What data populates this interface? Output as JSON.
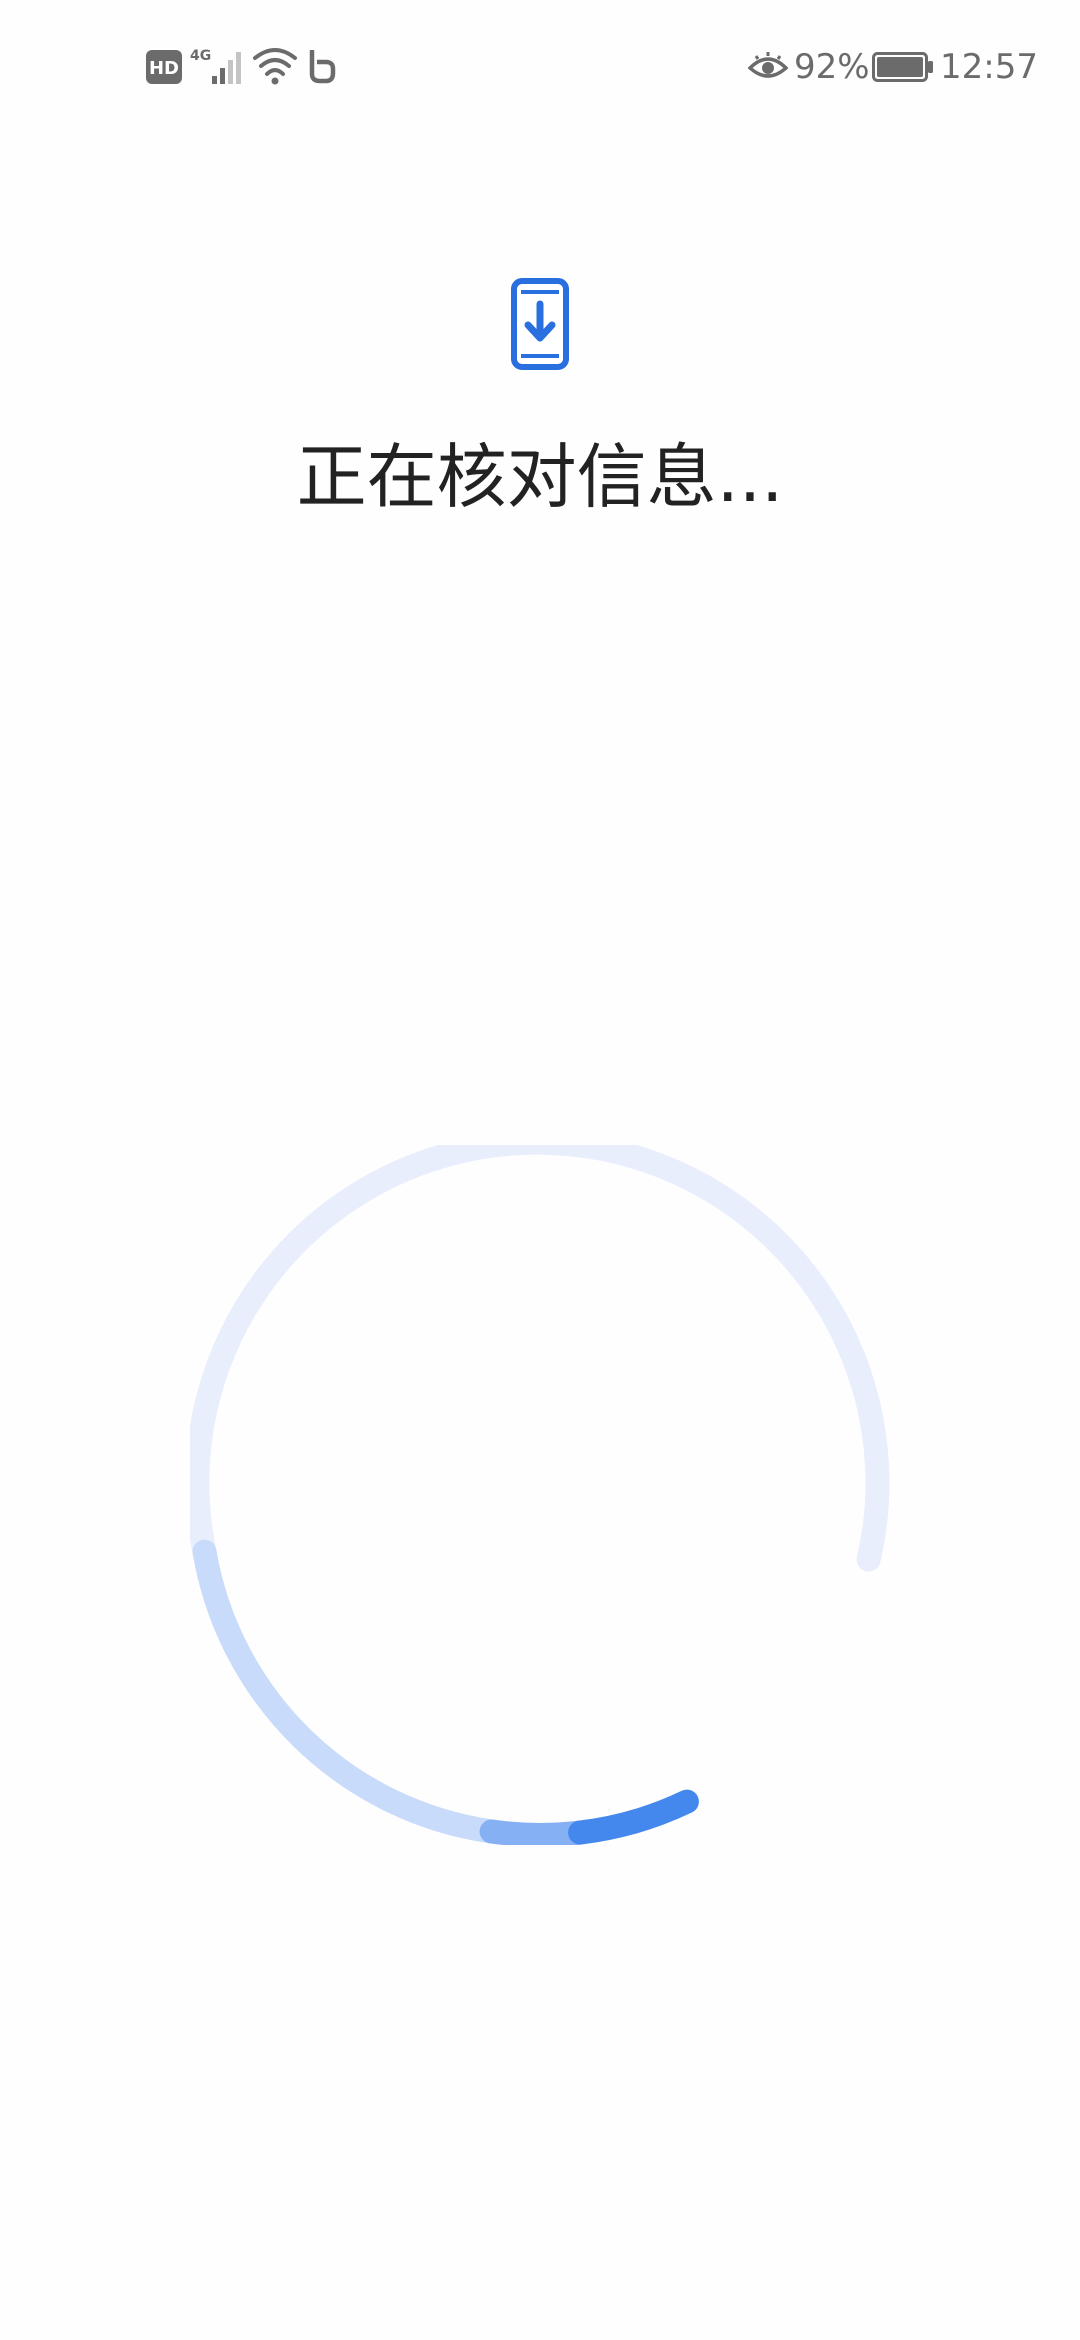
{
  "status_bar": {
    "hd_label": "HD",
    "network_label": "4G",
    "battery_percent": "92%",
    "time": "12:57",
    "icons": [
      "hd-icon",
      "signal-4g-icon",
      "wifi-icon",
      "app-notification-icon",
      "eye-comfort-icon",
      "battery-icon"
    ]
  },
  "main": {
    "icon": "phone-download-icon",
    "title": "正在核对信息..."
  },
  "spinner": {
    "icon": "loading-spinner",
    "track_color": "#e8eefc",
    "accent_color": "#4488ee",
    "mid_color": "#86b0f4",
    "light_color": "#c9dbfa"
  },
  "colors": {
    "background": "#fefefe",
    "icon_blue": "#2a6fe0",
    "text": "#222222",
    "status_text": "#6b6b6b"
  }
}
